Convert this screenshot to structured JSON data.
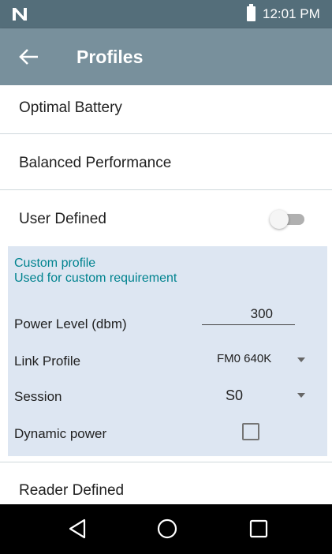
{
  "status_bar": {
    "time": "12:01 PM",
    "notification_icon": "n-logo-icon",
    "battery_icon": "battery-icon"
  },
  "app_bar": {
    "title": "Profiles",
    "back_icon": "arrow-back-icon"
  },
  "profiles": {
    "optimal_battery": "Optimal Battery",
    "balanced_performance": "Balanced Performance",
    "user_defined": "User Defined",
    "user_defined_enabled": false,
    "reader_defined": "Reader Defined"
  },
  "custom": {
    "title": "Custom profile",
    "subtitle": "Used for custom requirement",
    "power_level_label": "Power Level (dbm)",
    "power_level_value": "300",
    "link_profile_label": "Link Profile",
    "link_profile_value": "FM0 640K",
    "session_label": "Session",
    "session_value": "S0",
    "dynamic_power_label": "Dynamic power",
    "dynamic_power_checked": false
  },
  "nav": {
    "back": "nav-back-icon",
    "home": "nav-home-icon",
    "recents": "nav-recents-icon"
  },
  "colors": {
    "status_bar": "#546e7a",
    "app_bar": "#78909c",
    "panel": "#dde6f2",
    "accent_text": "#00838f"
  }
}
